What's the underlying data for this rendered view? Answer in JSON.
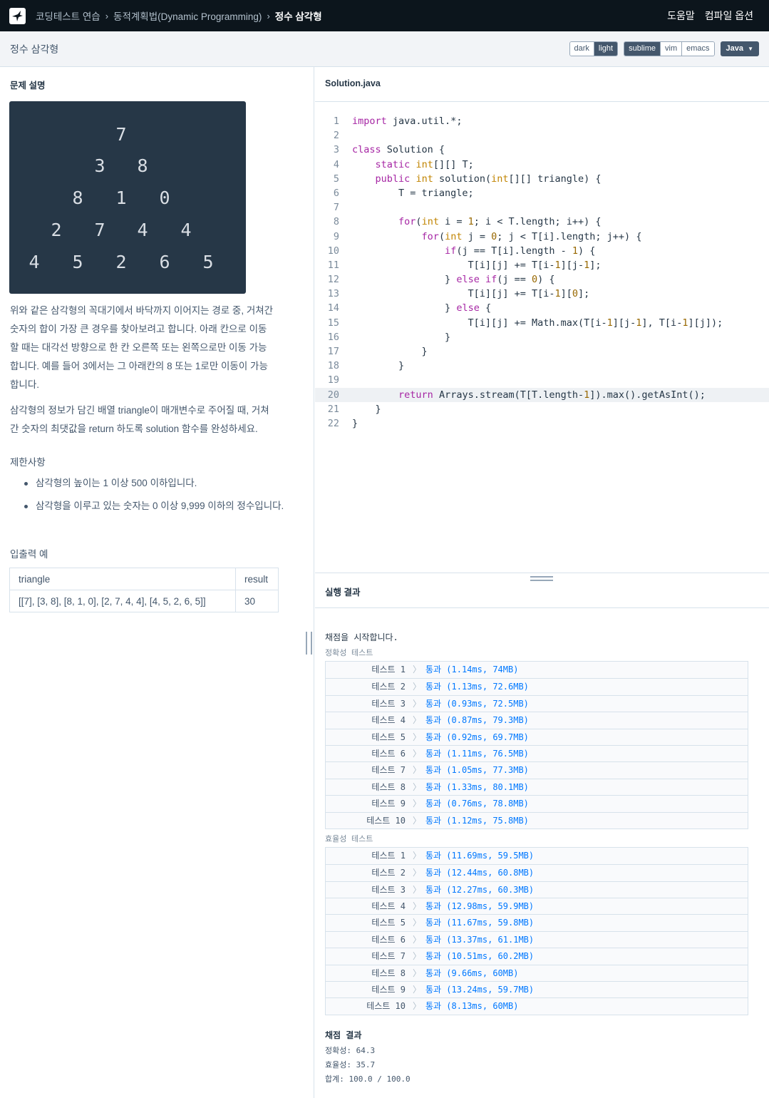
{
  "nav": {
    "breadcrumbs": [
      "코딩테스트 연습",
      "동적계획법(Dynamic Programming)"
    ],
    "current": "정수 삼각형",
    "help": "도움말",
    "compile_options": "컴파일 옵션"
  },
  "subheader": {
    "title": "정수 삼각형",
    "theme": [
      "dark",
      "light"
    ],
    "keymap": [
      "sublime",
      "vim",
      "emacs"
    ],
    "language": "Java"
  },
  "problem": {
    "section_title": "문제 설명",
    "triangle_rows": [
      [
        "7"
      ],
      [
        "3",
        "8"
      ],
      [
        "8",
        "1",
        "0"
      ],
      [
        "2",
        "7",
        "4",
        "4"
      ],
      [
        "4",
        "5",
        "2",
        "6",
        "5"
      ]
    ],
    "desc1_lines": [
      "위와 같은 삼각형의 꼭대기에서 바닥까지 이어지는 경로 중, 거쳐간",
      "숫자의 합이 가장 큰 경우를 찾아보려고 합니다. 아래 칸으로 이동",
      "할 때는 대각선 방향으로 한 칸 오른쪽 또는 왼쪽으로만 이동 가능",
      "합니다. 예를 들어 3에서는 그 아래칸의 8 또는 1로만 이동이 가능",
      "합니다."
    ],
    "desc2_lines": [
      "삼각형의 정보가 담긴 배열 triangle이 매개변수로 주어질 때, 거쳐",
      "간 숫자의 최댓값을 return 하도록 solution 함수를 완성하세요."
    ],
    "constraints_title": "제한사항",
    "constraints": [
      "삼각형의 높이는 1 이상 500 이하입니다.",
      "삼각형을 이루고 있는 숫자는 0 이상 9,999 이하의 정수입니다."
    ],
    "io_title": "입출력 예",
    "io_headers": [
      "triangle",
      "result"
    ],
    "io_rows": [
      [
        "[[7], [3, 8], [8, 1, 0], [2, 7, 4, 4], [4, 5, 2, 6, 5]]",
        "30"
      ]
    ]
  },
  "editor": {
    "filename": "Solution.java",
    "lines": [
      "import java.util.*;",
      "",
      "class Solution {",
      "    static int[][] T;",
      "    public int solution(int[][] triangle) {",
      "        T = triangle;",
      "",
      "        for(int i = 1; i < T.length; i++) {",
      "            for(int j = 0; j < T[i].length; j++) {",
      "                if(j == T[i].length - 1) {",
      "                    T[i][j] += T[i-1][j-1];",
      "                } else if(j == 0) {",
      "                    T[i][j] += T[i-1][0];",
      "                } else {",
      "                    T[i][j] += Math.max(T[i-1][j-1], T[i-1][j]);",
      "                }",
      "            }",
      "        }",
      "",
      "        return Arrays.stream(T[T.length-1]).max().getAsInt();",
      "    }",
      "}"
    ],
    "highlighted_line": 20
  },
  "result": {
    "title": "실행 결과",
    "start_msg": "채점을 시작합니다.",
    "accuracy_label": "정확성  테스트",
    "accuracy_tests": [
      {
        "name": "테스트 1",
        "result": "통과 (1.14ms, 74MB)"
      },
      {
        "name": "테스트 2",
        "result": "통과 (1.13ms, 72.6MB)"
      },
      {
        "name": "테스트 3",
        "result": "통과 (0.93ms, 72.5MB)"
      },
      {
        "name": "테스트 4",
        "result": "통과 (0.87ms, 79.3MB)"
      },
      {
        "name": "테스트 5",
        "result": "통과 (0.92ms, 69.7MB)"
      },
      {
        "name": "테스트 6",
        "result": "통과 (1.11ms, 76.5MB)"
      },
      {
        "name": "테스트 7",
        "result": "통과 (1.05ms, 77.3MB)"
      },
      {
        "name": "테스트 8",
        "result": "통과 (1.33ms, 80.1MB)"
      },
      {
        "name": "테스트 9",
        "result": "통과 (0.76ms, 78.8MB)"
      },
      {
        "name": "테스트 10",
        "result": "통과 (1.12ms, 75.8MB)"
      }
    ],
    "efficiency_label": "효율성  테스트",
    "efficiency_tests": [
      {
        "name": "테스트 1",
        "result": "통과 (11.69ms, 59.5MB)"
      },
      {
        "name": "테스트 2",
        "result": "통과 (12.44ms, 60.8MB)"
      },
      {
        "name": "테스트 3",
        "result": "통과 (12.27ms, 60.3MB)"
      },
      {
        "name": "테스트 4",
        "result": "통과 (12.98ms, 59.9MB)"
      },
      {
        "name": "테스트 5",
        "result": "통과 (11.67ms, 59.8MB)"
      },
      {
        "name": "테스트 6",
        "result": "통과 (13.37ms, 61.1MB)"
      },
      {
        "name": "테스트 7",
        "result": "통과 (10.51ms, 60.2MB)"
      },
      {
        "name": "테스트 8",
        "result": "통과 (9.66ms, 60MB)"
      },
      {
        "name": "테스트 9",
        "result": "통과 (13.24ms, 59.7MB)"
      },
      {
        "name": "테스트 10",
        "result": "통과 (8.13ms, 60MB)"
      }
    ],
    "final_title": "채점 결과",
    "final_lines": [
      "정확성: 64.3",
      "효율성: 35.7",
      "합계: 100.0 / 100.0"
    ]
  }
}
